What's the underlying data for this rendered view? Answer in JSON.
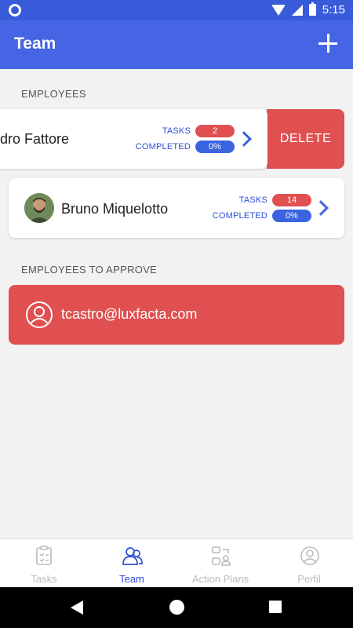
{
  "status_bar": {
    "time": "5:15"
  },
  "app_bar": {
    "title": "Team",
    "add_icon": "plus-icon"
  },
  "sections": {
    "employees": "EMPLOYEES",
    "to_approve": "EMPLOYEES TO APPROVE"
  },
  "employees": [
    {
      "name": "dro Fattore",
      "tasks_label": "TASKS",
      "tasks": "2",
      "completed_label": "COMPLETED",
      "completed": "0%"
    },
    {
      "name": "Bruno Miquelotto",
      "tasks_label": "TASKS",
      "tasks": "14",
      "completed_label": "COMPLETED",
      "completed": "0%"
    }
  ],
  "swipe_action": {
    "delete_label": "DELETE"
  },
  "pending": [
    {
      "email": "tcastro@luxfacta.com"
    }
  ],
  "bottom_nav": [
    {
      "label": "Tasks",
      "icon": "clipboard-check-icon",
      "active": false
    },
    {
      "label": "Team",
      "icon": "users-icon",
      "active": true
    },
    {
      "label": "Action Plans",
      "icon": "action-plans-icon",
      "active": false
    },
    {
      "label": "Perfil",
      "icon": "user-circle-icon",
      "active": false
    }
  ],
  "colors": {
    "primary": "#4565e5",
    "danger": "#e05050",
    "accent_blue": "#3b63e0"
  }
}
